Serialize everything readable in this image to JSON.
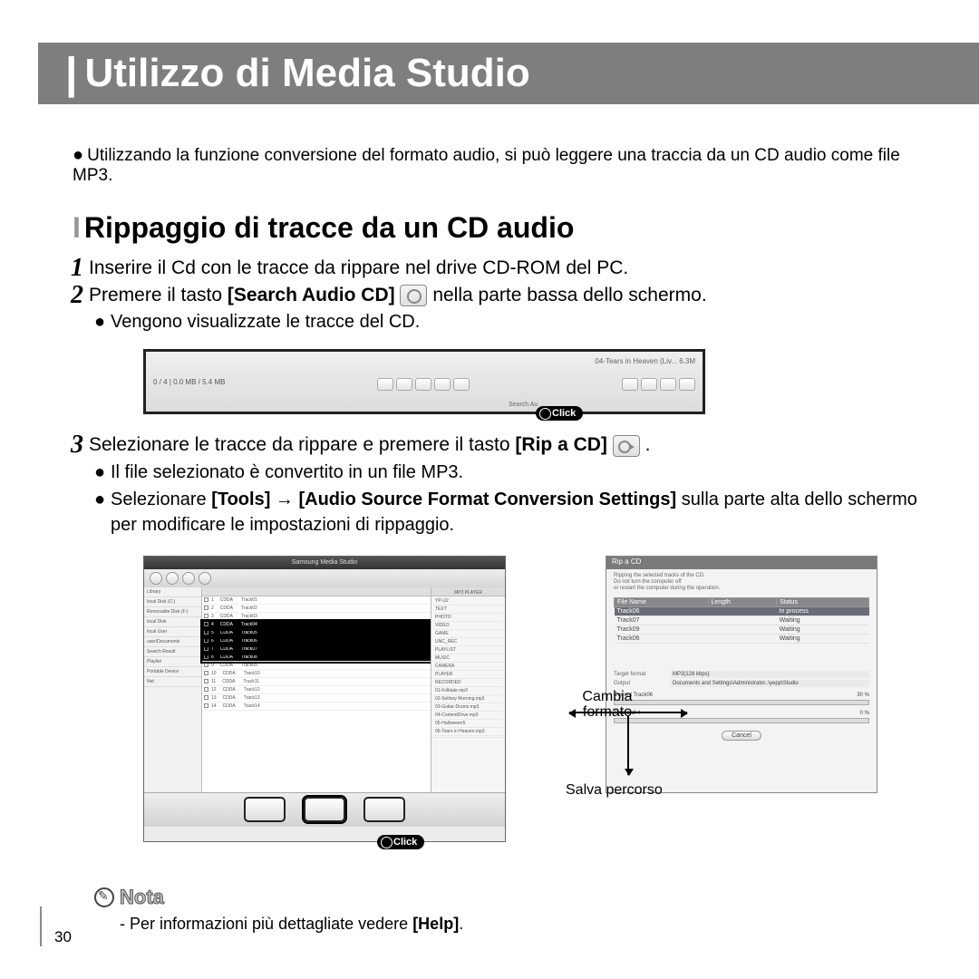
{
  "page_number": "30",
  "title": "Utilizzo di Media Studio",
  "intro": "Utilizzando la funzione conversione del formato audio, si può leggere una traccia da un CD audio come file MP3.",
  "section": "Rippaggio di tracce da un CD audio",
  "step1": "Inserire il Cd con le tracce da rippare nel drive CD-ROM del PC.",
  "step2_a": "Premere il tasto ",
  "step2_bold": "[Search Audio CD]",
  "step2_b": " nella parte bassa dello schermo.",
  "step2_sub": "Vengono visualizzate le tracce del CD.",
  "step3_a": "Selezionare le tracce da rippare e premere il tasto ",
  "step3_bold": "[Rip a CD]",
  "step3_dot": " .",
  "step3_sub1": "Il file selezionato è convertito in un file MP3.",
  "step3_sub2_a": "Selezionare ",
  "step3_sub2_b1": "[Tools]",
  "step3_sub2_arrow": " → ",
  "step3_sub2_b2": "[Audio Source Format Conversion Settings]",
  "step3_sub2_c": " sulla parte alta dello schermo per modificare le impostazioni di rippaggio.",
  "click_label": "Click",
  "app_title": "Samsung Media Studio",
  "pane_left": [
    "Library",
    "local Disk (C:)",
    "Removable Disk (F:)",
    "local Disk",
    "local User",
    "user\\Documents",
    "Search Result",
    "Playlist",
    "Portable Device",
    "Net"
  ],
  "tracks": [
    "Track01",
    "Track02",
    "Track03",
    "Track04",
    "Track05",
    "Track06",
    "Track07",
    "Track08",
    "Track09",
    "Track10",
    "Track11",
    "Track12",
    "Track13",
    "Track14"
  ],
  "pane_right_hdr": "MP3 PLAYER",
  "pane_right": [
    "YP-U2",
    "TEXT",
    "PHOTO",
    "VIDEO",
    "GAME",
    "UNC_REC",
    "PLAYLIST",
    "MUSIC",
    "CAMERA",
    "PLAYER",
    "RECORDED",
    "01-Folktale.mp3",
    "02-Solitary Morning.mp3",
    "03-Guitar-Drums.mp3",
    "04-ContentDrive.mp3",
    "05-Halloween5",
    "06-Tears in Heaven.mp3"
  ],
  "dialog_title": "Rip a CD",
  "dialog_msg1": "Ripping the selected tracks of the CD.",
  "dialog_msg2": "Do not turn the computer off",
  "dialog_msg3": "or restart the computer during the operation.",
  "th_file": "File Name",
  "th_len": "Length",
  "th_stat": "Status",
  "rows": [
    {
      "n": "Track06",
      "s": "In process"
    },
    {
      "n": "Track07",
      "s": "Waiting"
    },
    {
      "n": "Track09",
      "s": "Waiting"
    },
    {
      "n": "Track06",
      "s": "Waiting"
    }
  ],
  "fmt_label": "Target format",
  "fmt_val": "MP3(128 kbps)",
  "path_label": "Output",
  "path_val": "Documents and Settings\\Administrator..\\yepp\\Studio",
  "cur_label": "Current  Track06",
  "cur_pct": "30 %",
  "tot_label": "Total  1 of 4",
  "tot_pct": "0 %",
  "cancel": "Cancel",
  "anno_change": "Cambia formato",
  "anno_save": "Salva percorso",
  "nota_h": "Nota",
  "nota_line_a": "- Per informazioni più dettagliate vedere ",
  "nota_line_b": "[Help]",
  "nota_line_c": ".",
  "toolbar_np": "04-Tears in Heaven (Liv...    6.3M",
  "toolbar_prog": "0 / 4   |   0.0 MB / 5.4 MB",
  "toolbar_search": "Search Au"
}
